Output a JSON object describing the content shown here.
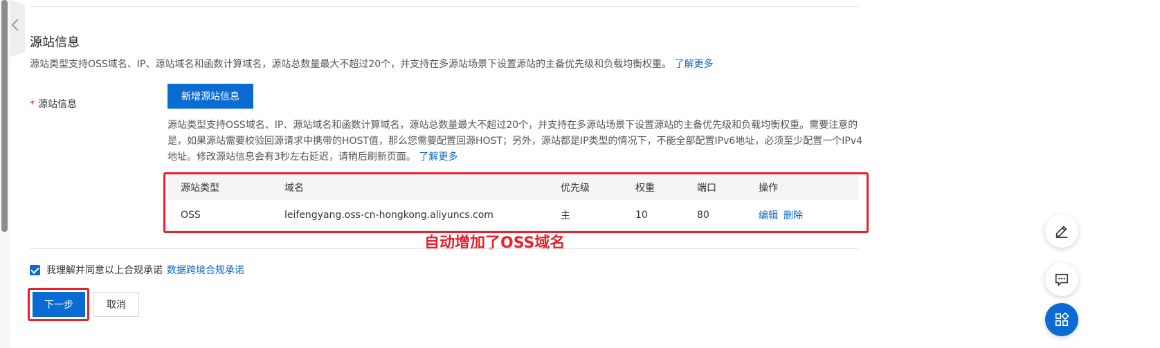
{
  "section": {
    "title": "源站信息",
    "description": "源站类型支持OSS域名、IP、源站域名和函数计算域名，源站总数量最大不超过20个，并支持在多源站场景下设置源站的主备优先级和负载均衡权重。",
    "learn_more": "了解更多"
  },
  "form": {
    "required_mark": "*",
    "label": "源站信息",
    "add_button": "新增源站信息",
    "help_text": "源站类型支持OSS域名、IP、源站域名和函数计算域名，源站总数量最大不超过20个，并支持在多源站场景下设置源站的主备优先级和负载均衡权重。需要注意的是，如果源站需要校验回源请求中携带的HOST值，那么您需要配置回源HOST；另外，源站都是IP类型的情况下，不能全部配置IPv6地址，必须至少配置一个IPv4地址。修改源站信息会有3秒左右延迟，请稍后刷新页面。",
    "help_learn_more": "了解更多"
  },
  "table": {
    "headers": [
      "源站类型",
      "域名",
      "优先级",
      "权重",
      "端口",
      "操作"
    ],
    "rows": [
      {
        "type": "OSS",
        "domain": "leifengyang.oss-cn-hongkong.aliyuncs.com",
        "priority": "主",
        "weight": "10",
        "port": "80",
        "edit": "编辑",
        "delete": "删除"
      }
    ]
  },
  "annotation": "自动增加了OSS域名",
  "agreement": {
    "text": "我理解并同意以上合规承诺",
    "link": "数据跨境合规承诺",
    "checked": true
  },
  "actions": {
    "next": "下一步",
    "cancel": "取消"
  },
  "colors": {
    "primary": "#0a6cd3",
    "highlight": "#e8202c",
    "link": "#0b66c8"
  },
  "icons": [
    "chevron-left-icon",
    "edit-icon",
    "chat-icon",
    "apps-icon"
  ]
}
